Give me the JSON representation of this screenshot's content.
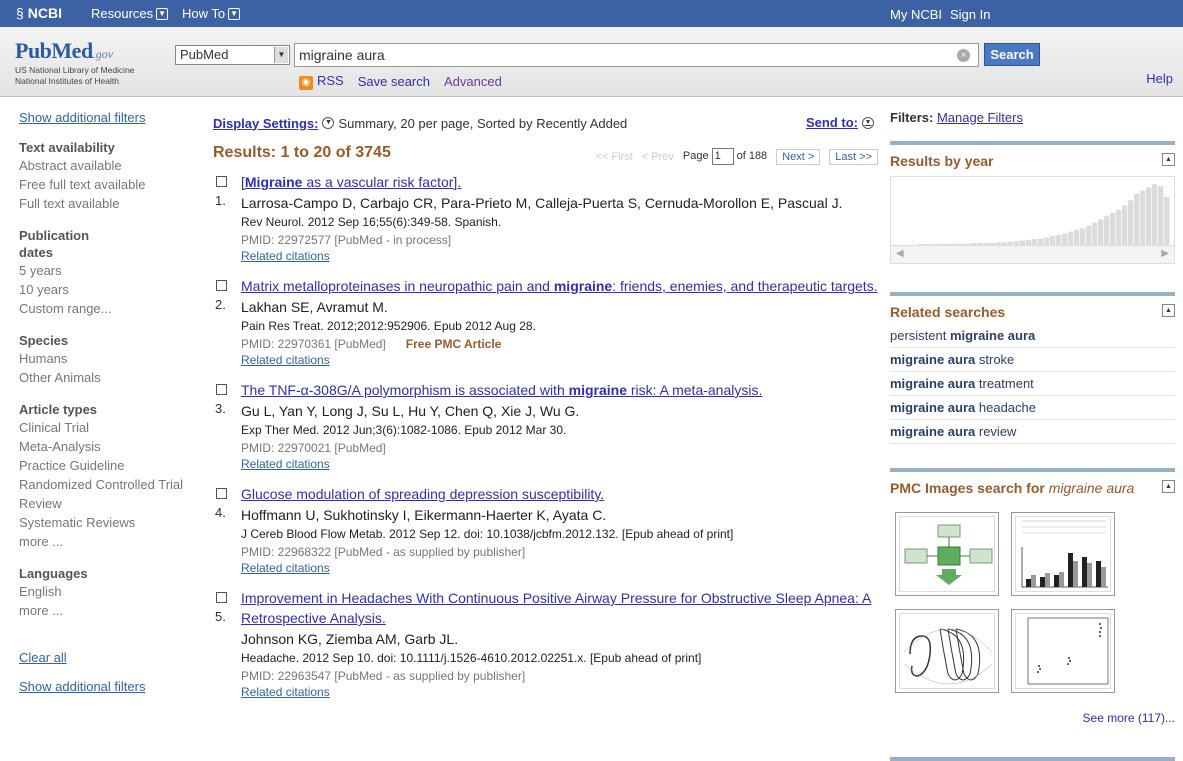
{
  "topbar": {
    "ncbi": "NCBI",
    "resources": "Resources",
    "howto": "How To",
    "my_ncbi": "My NCBI",
    "sign_in": "Sign In"
  },
  "header": {
    "logo_pub": "PubMed",
    "logo_gov": ".gov",
    "logo_line1": "US National Library of Medicine",
    "logo_line2": "National Institutes of Health",
    "database": "PubMed",
    "query": "migraine aura",
    "search_label": "Search",
    "rss": "RSS",
    "save_search": "Save search",
    "advanced": "Advanced",
    "help": "Help"
  },
  "left": {
    "show_filters_top": "Show additional filters",
    "groups": [
      {
        "head": "Text availability",
        "items": [
          "Abstract available",
          "Free full text available",
          "Full text available"
        ]
      },
      {
        "head": "Publication dates",
        "items": [
          "5 years",
          "10 years",
          "Custom range..."
        ]
      },
      {
        "head": "Species",
        "items": [
          "Humans",
          "Other Animals"
        ]
      },
      {
        "head": "Article types",
        "items": [
          "Clinical Trial",
          "Meta-Analysis",
          "Practice Guideline",
          "Randomized Controlled Trial",
          "Review",
          "Systematic Reviews",
          "more ..."
        ]
      },
      {
        "head": "Languages",
        "items": [
          "English",
          "more ..."
        ]
      }
    ],
    "clear_all": "Clear all",
    "show_filters_bottom": "Show additional filters"
  },
  "main": {
    "display_settings": "Display Settings:",
    "display_summary": "Summary, 20 per page, Sorted by Recently Added",
    "send_to": "Send to:",
    "results_title": "Results: 1 to 20 of 3745",
    "pager": {
      "first": "<< First",
      "prev": "< Prev",
      "page_label": "Page",
      "page_value": "1",
      "of": "of 188",
      "next": "Next >",
      "last": "Last >>"
    },
    "results": [
      {
        "num": "1.",
        "title_pre": "[",
        "title_bold": "Migraine",
        "title_post": " as a vascular risk factor].",
        "authors": "Larrosa-Campo D, Carbajo CR, Para-Prieto M, Calleja-Puerta S, Cernuda-Morollon E, Pascual J.",
        "journal": "Rev Neurol. 2012 Sep 16;55(6):349-58. Spanish.",
        "pmid": "PMID: 22972577 [PubMed - in process]",
        "free": "",
        "related": "Related citations"
      },
      {
        "num": "2.",
        "title_pre": "Matrix metalloproteinases in neuropathic pain and ",
        "title_bold": "migraine",
        "title_post": ": friends, enemies, and therapeutic targets.",
        "authors": "Lakhan SE, Avramut M.",
        "journal": "Pain Res Treat. 2012;2012:952906. Epub 2012 Aug 28.",
        "pmid": "PMID: 22970361 [PubMed]",
        "free": "Free PMC Article",
        "related": "Related citations"
      },
      {
        "num": "3.",
        "title_pre": "The TNF-α-308G/A polymorphism is associated with ",
        "title_bold": "migraine",
        "title_post": " risk: A meta-analysis.",
        "authors": "Gu L, Yan Y, Long J, Su L, Hu Y, Chen Q, Xie J, Wu G.",
        "journal": "Exp Ther Med. 2012 Jun;3(6):1082-1086. Epub 2012 Mar 30.",
        "pmid": "PMID: 22970021 [PubMed]",
        "free": "",
        "related": "Related citations"
      },
      {
        "num": "4.",
        "title_pre": "Glucose modulation of spreading depression susceptibility.",
        "title_bold": "",
        "title_post": "",
        "authors": "Hoffmann U, Sukhotinsky I, Eikermann-Haerter K, Ayata C.",
        "journal": "J Cereb Blood Flow Metab. 2012 Sep 12. doi: 10.1038/jcbfm.2012.132. [Epub ahead of print]",
        "pmid": "PMID: 22968322 [PubMed - as supplied by publisher]",
        "free": "",
        "related": "Related citations"
      },
      {
        "num": "5.",
        "title_pre": "Improvement in Headaches With Continuous Positive Airway Pressure for Obstructive Sleep Apnea: A Retrospective Analysis.",
        "title_bold": "",
        "title_post": "",
        "authors": "Johnson KG, Ziemba AM, Garb JL.",
        "journal": "Headache. 2012 Sep 10. doi: 10.1111/j.1526-4610.2012.02251.x. [Epub ahead of print]",
        "pmid": "PMID: 22963547 [PubMed - as supplied by publisher]",
        "free": "",
        "related": "Related citations"
      }
    ]
  },
  "right": {
    "filters_label": "Filters:",
    "manage_filters": "Manage Filters",
    "results_by_year": "Results by year",
    "year_bars": [
      0.01,
      0.01,
      0.01,
      0.01,
      0.01,
      0.02,
      0.02,
      0.02,
      0.02,
      0.03,
      0.03,
      0.03,
      0.03,
      0.04,
      0.04,
      0.05,
      0.06,
      0.07,
      0.08,
      0.09,
      0.1,
      0.12,
      0.14,
      0.16,
      0.18,
      0.21,
      0.24,
      0.26,
      0.3,
      0.35,
      0.4,
      0.45,
      0.5,
      0.55,
      0.62,
      0.7,
      0.8,
      0.85,
      0.9,
      0.95,
      0.92,
      0.75
    ],
    "related_searches_title": "Related searches",
    "related_searches": [
      {
        "pre": "persistent ",
        "bold": "migraine aura",
        "post": ""
      },
      {
        "pre": "",
        "bold": "migraine aura",
        "post": " stroke"
      },
      {
        "pre": "",
        "bold": "migraine aura",
        "post": " treatment"
      },
      {
        "pre": "",
        "bold": "migraine aura",
        "post": " headache"
      },
      {
        "pre": "",
        "bold": "migraine aura",
        "post": " review"
      }
    ],
    "pmc_title": "PMC Images search for ",
    "pmc_query": "migraine aura",
    "see_more": "See more (117)...",
    "colors": {
      "bar": "#dcdcdc",
      "panel_border": "#97b0c8",
      "accent": "#9a5a2a"
    }
  }
}
